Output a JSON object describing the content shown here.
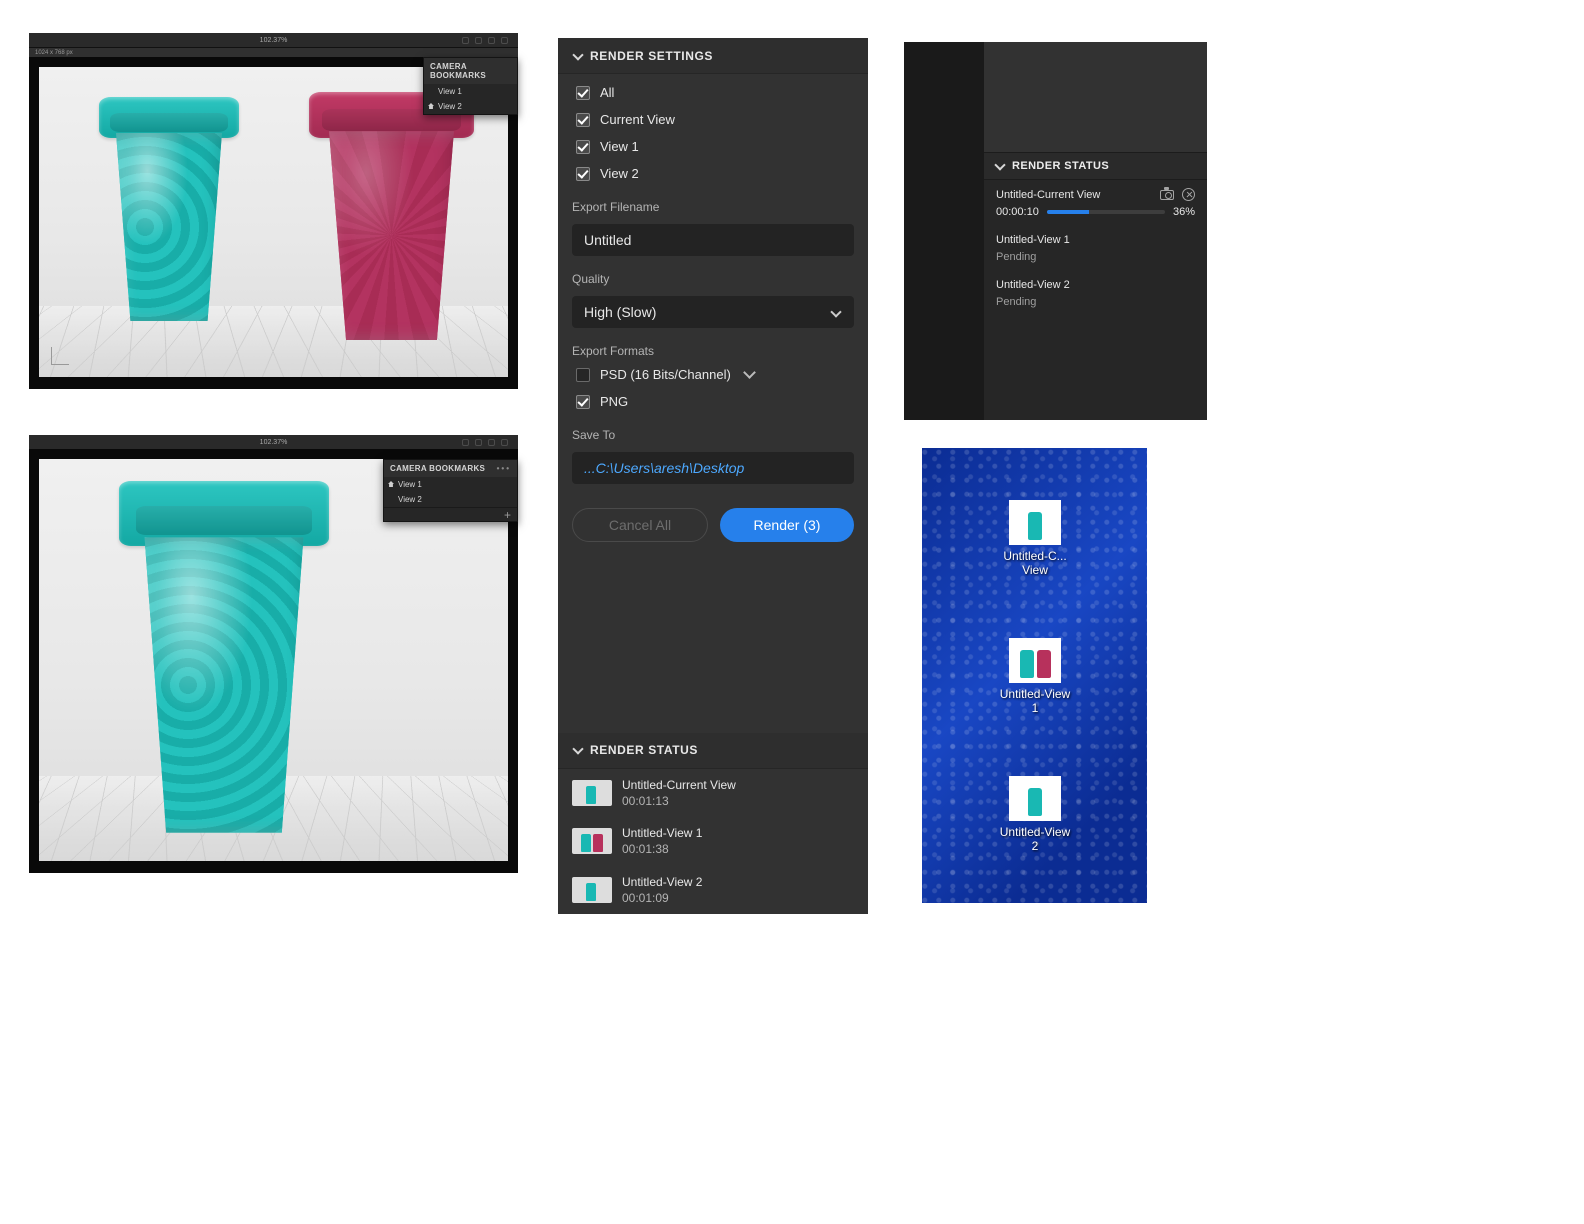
{
  "viewport1": {
    "zoom": "102.37%",
    "dims": "1024 x 768 px",
    "bookmarks": {
      "title": "CAMERA BOOKMARKS",
      "items": [
        "View 1",
        "View 2"
      ]
    }
  },
  "viewport2": {
    "zoom": "102.37%",
    "bookmarks": {
      "title": "CAMERA BOOKMARKS",
      "items": [
        "View 1",
        "View 2"
      ]
    }
  },
  "render_settings": {
    "title": "RENDER SETTINGS",
    "checks": {
      "all": {
        "label": "All",
        "checked": true
      },
      "current": {
        "label": "Current View",
        "checked": true
      },
      "view1": {
        "label": "View 1",
        "checked": true
      },
      "view2": {
        "label": "View 2",
        "checked": true
      }
    },
    "filename_label": "Export Filename",
    "filename_value": "Untitled",
    "quality_label": "Quality",
    "quality_value": "High (Slow)",
    "formats_label": "Export Formats",
    "formats": {
      "psd": {
        "label": "PSD (16 Bits/Channel)",
        "checked": false,
        "has_submenu": true
      },
      "png": {
        "label": "PNG",
        "checked": true,
        "has_submenu": false
      }
    },
    "saveto_label": "Save To",
    "saveto_value": "...C:\\Users\\aresh\\Desktop",
    "cancel_label": "Cancel All",
    "render_label": "Render (3)"
  },
  "render_status_done": {
    "title": "RENDER STATUS",
    "items": [
      {
        "name": "Untitled-Current View",
        "time": "00:01:13",
        "thumb": "one"
      },
      {
        "name": "Untitled-View 1",
        "time": "00:01:38",
        "thumb": "two"
      },
      {
        "name": "Untitled-View 2",
        "time": "00:01:09",
        "thumb": "one"
      }
    ]
  },
  "render_status_progress": {
    "title": "RENDER STATUS",
    "active": {
      "name": "Untitled-Current View",
      "elapsed": "00:00:10",
      "percent": "36%",
      "percent_num": 36
    },
    "pending": [
      {
        "name": "Untitled-View 1",
        "state": "Pending"
      },
      {
        "name": "Untitled-View 2",
        "state": "Pending"
      }
    ]
  },
  "desktop": {
    "icons": [
      {
        "label": "Untitled-C...\nView",
        "thumb": "one"
      },
      {
        "label": "Untitled-View\n1",
        "thumb": "two"
      },
      {
        "label": "Untitled-View\n2",
        "thumb": "one"
      }
    ]
  }
}
